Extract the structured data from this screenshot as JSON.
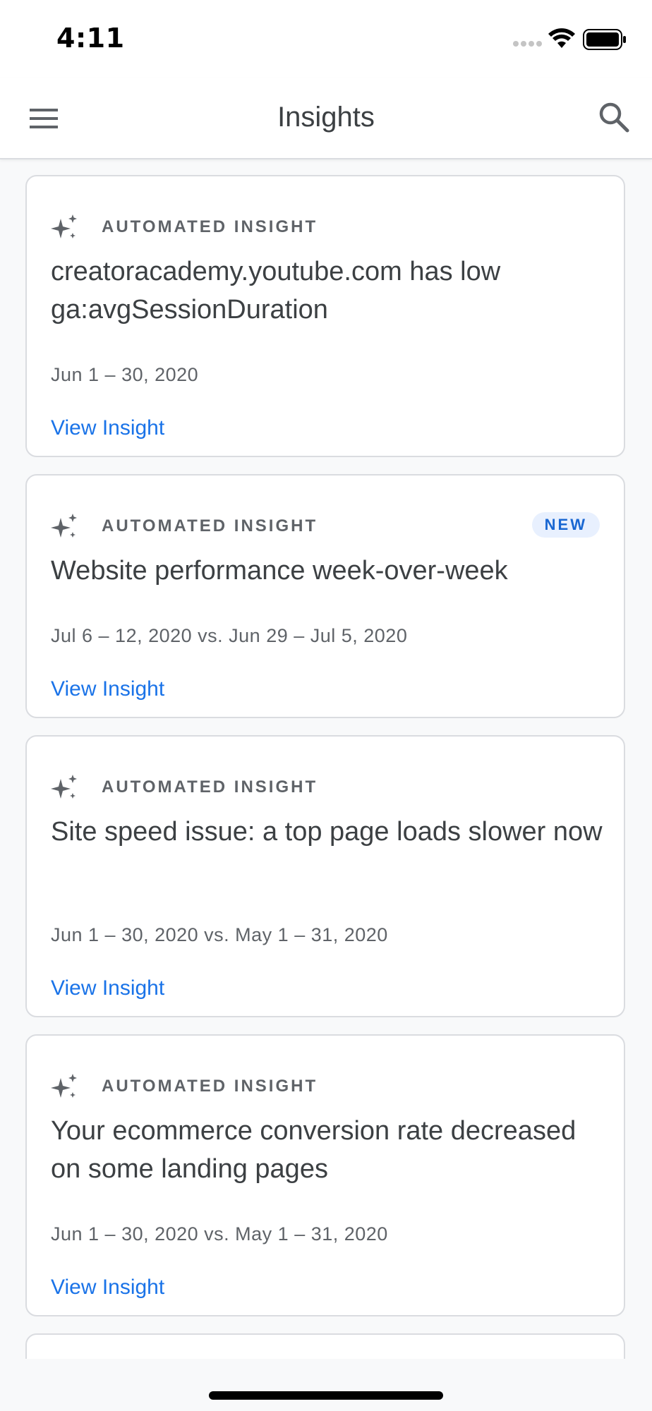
{
  "status_bar": {
    "time": "4:11"
  },
  "app_bar": {
    "title": "Insights",
    "menu_icon": "hamburger-menu-icon",
    "search_icon": "search-icon"
  },
  "colors": {
    "accent": "#1a73e8",
    "badge_bg": "#e8f0fe",
    "badge_text": "#1967d2",
    "text_primary": "#3c4043",
    "text_secondary": "#5f6368",
    "background": "#f8f9fa"
  },
  "cards": [
    {
      "label": "AUTOMATED INSIGHT",
      "icon": "sparkle-icon",
      "badge": "",
      "title": "creatoracademy.youtube.com has low ga:avgSessionDuration",
      "date": "Jun 1 – 30, 2020",
      "link": "View Insight"
    },
    {
      "label": "AUTOMATED INSIGHT",
      "icon": "sparkle-icon",
      "badge": "NEW",
      "title": "Website performance week-over-week",
      "date": "Jul 6 – 12, 2020 vs. Jun 29 – Jul 5, 2020",
      "link": "View Insight"
    },
    {
      "label": "AUTOMATED INSIGHT",
      "icon": "sparkle-icon",
      "badge": "",
      "title": "Site speed issue: a top page loads slower now",
      "date": "Jun 1 – 30, 2020 vs. May 1 – 31, 2020",
      "link": "View Insight"
    },
    {
      "label": "AUTOMATED INSIGHT",
      "icon": "sparkle-icon",
      "badge": "",
      "title": "Your ecommerce conversion rate decreased on some landing pages",
      "date": "Jun 1 – 30, 2020 vs. May 1 – 31, 2020",
      "link": "View Insight"
    }
  ]
}
